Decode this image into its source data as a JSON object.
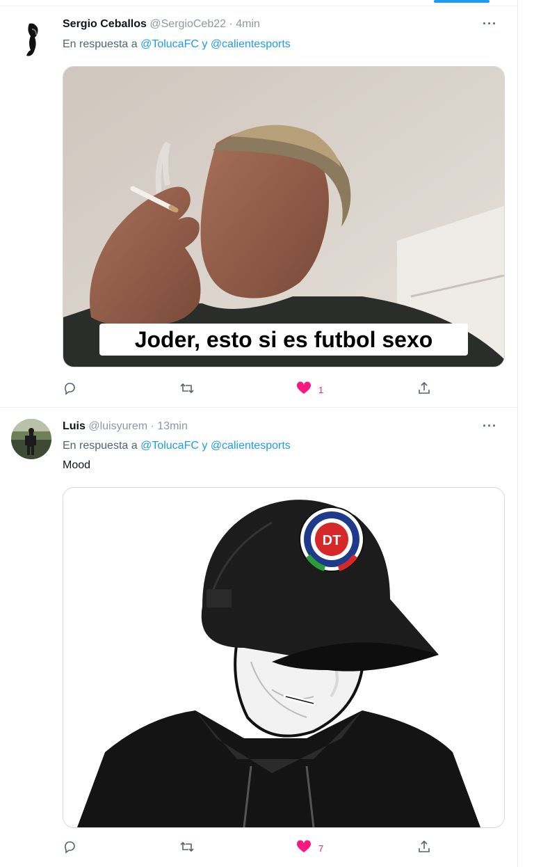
{
  "tweets": [
    {
      "name": "Sergio Ceballos",
      "handle": "@SergioCeb22",
      "time": "· 4min",
      "more": "···",
      "reply_prefix": "En respuesta a",
      "mention1": "@TolucaFC",
      "joiner": "y",
      "mention2": "@calientesports",
      "text": "",
      "caption": "Joder, esto si es futbol sexo",
      "likes": "1"
    },
    {
      "name": "Luis",
      "handle": "@luisyurem",
      "time": "· 13min",
      "more": "···",
      "reply_prefix": "En respuesta a",
      "mention1": "@TolucaFC",
      "joiner": "y",
      "mention2": "@calientesports",
      "text": "Mood",
      "caption": "",
      "likes": "7",
      "cap_patch_line1": "",
      "cap_patch_line2": ""
    }
  ],
  "colors": {
    "link": "#1d9bf0",
    "like": "#f91880",
    "icon": "#536471"
  },
  "icons": [
    "reply-icon",
    "retweet-icon",
    "like-icon",
    "share-icon",
    "more-icon"
  ]
}
